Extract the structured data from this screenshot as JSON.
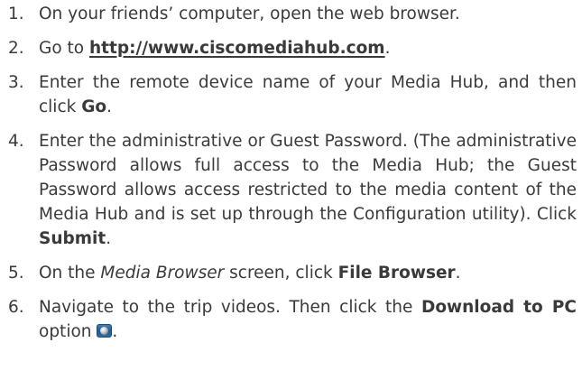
{
  "steps": [
    {
      "number": "1.",
      "text": "On your friends’ computer, open the web browser."
    },
    {
      "number": "2.",
      "text_before": "Go to ",
      "url": "http://www.ciscomediahub.com",
      "text_after": "."
    },
    {
      "number": "3.",
      "text_before": "Enter the remote device name of your Media Hub, and then click ",
      "bold": "Go",
      "text_after": "."
    },
    {
      "number": "4.",
      "text_before": "Enter the administrative or Guest Password. (The administrative Password allows full access to the Media Hub; the Guest Password allows access restricted to the media content of the Media Hub and is set up through the Configuration utility). Click ",
      "bold": "Submit",
      "text_after": "."
    },
    {
      "number": "5.",
      "text_before": "On the ",
      "italic": "Media Browser",
      "text_middle": " screen, click ",
      "bold": "File Browser",
      "text_after": "."
    },
    {
      "number": "6.",
      "text_before": "Navigate to the trip videos. Then click the ",
      "bold": "Download to PC",
      "text_middle": " option ",
      "icon": "download-to-pc-icon",
      "text_after": "."
    }
  ]
}
